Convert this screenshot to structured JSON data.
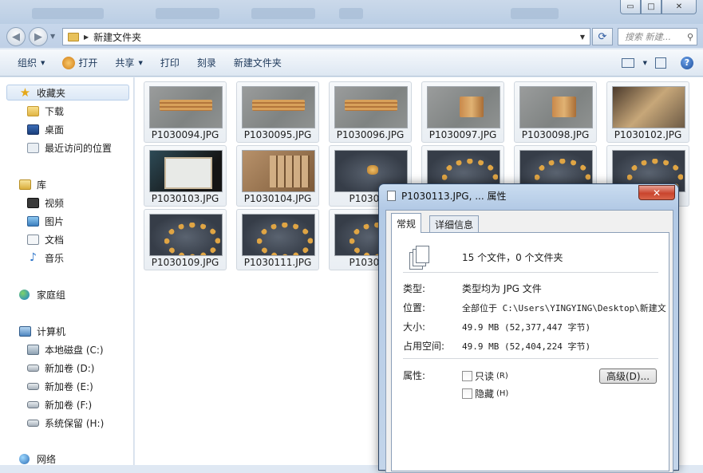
{
  "window": {
    "minimize_glyph": "▭",
    "maximize_glyph": "□",
    "close_glyph": "✕"
  },
  "address": {
    "path": "新建文件夹",
    "search_placeholder": "搜索 新建..."
  },
  "toolbar": {
    "organize": "组织",
    "open": "打开",
    "share": "共享",
    "print": "打印",
    "burn": "刻录",
    "new_folder": "新建文件夹"
  },
  "sidebar": {
    "favorites": "收藏夹",
    "downloads": "下载",
    "desktop": "桌面",
    "recent": "最近访问的位置",
    "libraries": "库",
    "videos": "视频",
    "pictures": "图片",
    "documents": "文档",
    "music": "音乐",
    "homegroup": "家庭组",
    "computer": "计算机",
    "drive_c": "本地磁盘 (C:)",
    "drive_d": "新加卷 (D:)",
    "drive_e": "新加卷 (E:)",
    "drive_f": "新加卷 (F:)",
    "drive_h": "系统保留 (H:)",
    "network": "网络"
  },
  "files": [
    {
      "name": "P1030094.JPG"
    },
    {
      "name": "P1030095.JPG"
    },
    {
      "name": "P1030096.JPG"
    },
    {
      "name": "P1030097.JPG"
    },
    {
      "name": "P1030098.JPG"
    },
    {
      "name": "P1030102.JPG"
    },
    {
      "name": "P1030103.JPG"
    },
    {
      "name": "P1030104.JPG"
    },
    {
      "name": "P103010"
    },
    {
      "name": ""
    },
    {
      "name": ""
    },
    {
      "name": ""
    },
    {
      "name": "P1030109.JPG"
    },
    {
      "name": "P1030111.JPG"
    },
    {
      "name": "P103011"
    }
  ],
  "dialog": {
    "title": "P1030113.JPG, ... 属性",
    "close": "✕",
    "tab_general": "常规",
    "tab_details": "详细信息",
    "count": "15 个文件，0 个文件夹",
    "type_label": "类型:",
    "type_value": "类型均为 JPG 文件",
    "location_label": "位置:",
    "location_value": "全部位于 C:\\Users\\YINGYING\\Desktop\\新建文",
    "size_label": "大小:",
    "size_value": "49.9 MB (52,377,447 字节)",
    "disk_label": "占用空间:",
    "disk_value": "49.9 MB (52,404,224 字节)",
    "attr_label": "属性:",
    "readonly": "只读",
    "readonly_key": "(R)",
    "hidden": "隐藏",
    "hidden_key": "(H)",
    "advanced": "高级(D)..."
  }
}
